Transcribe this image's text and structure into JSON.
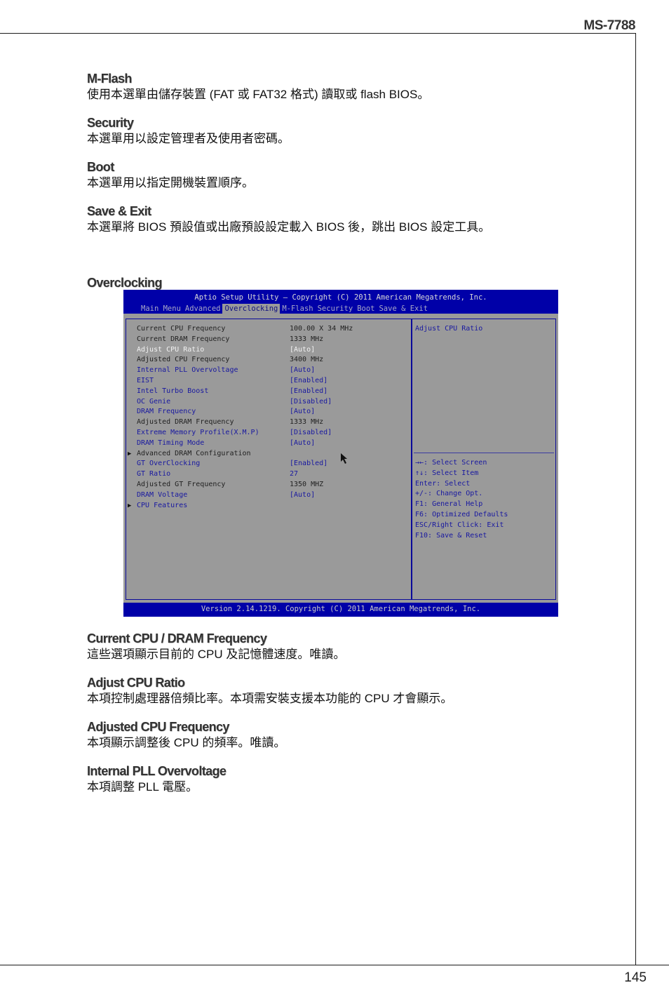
{
  "header": {
    "model": "MS-7788"
  },
  "footer": {
    "page_number": "145"
  },
  "sections_top": [
    {
      "title": "M-Flash",
      "body": "使用本選單由儲存裝置 (FAT 或 FAT32 格式) 讀取或 flash BIOS。"
    },
    {
      "title": "Security",
      "body": "本選單用以設定管理者及使用者密碼。"
    },
    {
      "title": "Boot",
      "body": "本選單用以指定開機裝置順序。"
    },
    {
      "title": "Save & Exit",
      "body": "本選單將 BIOS 預設值或出廠預設設定載入 BIOS 後，跳出 BIOS 設定工具。"
    }
  ],
  "overclocking_title": "Overclocking",
  "bios": {
    "title": "Aptio Setup Utility – Copyright (C) 2011 American Megatrends, Inc.",
    "tabs": [
      "Main Menu",
      "Advanced",
      "Overclocking",
      "M-Flash",
      "Security",
      "Boot",
      "Save & Exit"
    ],
    "active_tab": "Overclocking",
    "items": [
      {
        "label": "Current CPU Frequency",
        "value": "100.00 X 34 MHz",
        "style": "info"
      },
      {
        "label": "Current DRAM Frequency",
        "value": "1333 MHz",
        "style": "info"
      },
      {
        "label": "Adjust CPU Ratio",
        "value": "[Auto]",
        "style": "selected"
      },
      {
        "label": "Adjusted CPU Frequency",
        "value": "3400 MHz",
        "style": "info"
      },
      {
        "label": "Internal PLL Overvoltage",
        "value": "[Auto]",
        "style": "option"
      },
      {
        "label": "EIST",
        "value": "[Enabled]",
        "style": "option"
      },
      {
        "label": "Intel Turbo Boost",
        "value": "[Enabled]",
        "style": "option"
      },
      {
        "label": "OC Genie",
        "value": "[Disabled]",
        "style": "option"
      },
      {
        "label": "DRAM Frequency",
        "value": "[Auto]",
        "style": "option"
      },
      {
        "label": "Adjusted DRAM Frequency",
        "value": "1333 MHz",
        "style": "info"
      },
      {
        "label": "Extreme Memory Profile(X.M.P)",
        "value": "[Disabled]",
        "style": "option"
      },
      {
        "label": "DRAM Timing Mode",
        "value": "[Auto]",
        "style": "option"
      },
      {
        "label": "Advanced DRAM Configuration",
        "value": "",
        "style": "submenu"
      },
      {
        "label": "GT OverClocking",
        "value": "[Enabled]",
        "style": "option"
      },
      {
        "label": "GT Ratio",
        "value": "27",
        "style": "option"
      },
      {
        "label": "Adjusted GT Frequency",
        "value": "1350 MHZ",
        "style": "info"
      },
      {
        "label": "DRAM Voltage",
        "value": "[Auto]",
        "style": "option"
      },
      {
        "label": "CPU Features",
        "value": "",
        "style": "submenu-blue"
      }
    ],
    "help_title": "Adjust CPU Ratio",
    "help_keys": [
      "→←: Select Screen",
      "↑↓: Select Item",
      "Enter: Select",
      "+/-: Change Opt.",
      "F1: General Help",
      "F6: Optimized Defaults",
      "ESC/Right Click: Exit",
      "F10: Save & Reset"
    ],
    "footer": "Version 2.14.1219. Copyright (C) 2011 American Megatrends, Inc."
  },
  "sections_bottom": [
    {
      "title": "Current CPU / DRAM Frequency",
      "body": "這些選項顯示目前的 CPU 及記憶體速度。唯讀。"
    },
    {
      "title": "Adjust CPU Ratio",
      "body": "本項控制處理器倍頻比率。本項需安裝支援本功能的 CPU 才會顯示。"
    },
    {
      "title": "Adjusted CPU Frequency",
      "body": "本項顯示調整後 CPU 的頻率。唯讀。"
    },
    {
      "title": "Internal PLL Overvoltage",
      "body": "本項調整 PLL 電壓。"
    }
  ]
}
